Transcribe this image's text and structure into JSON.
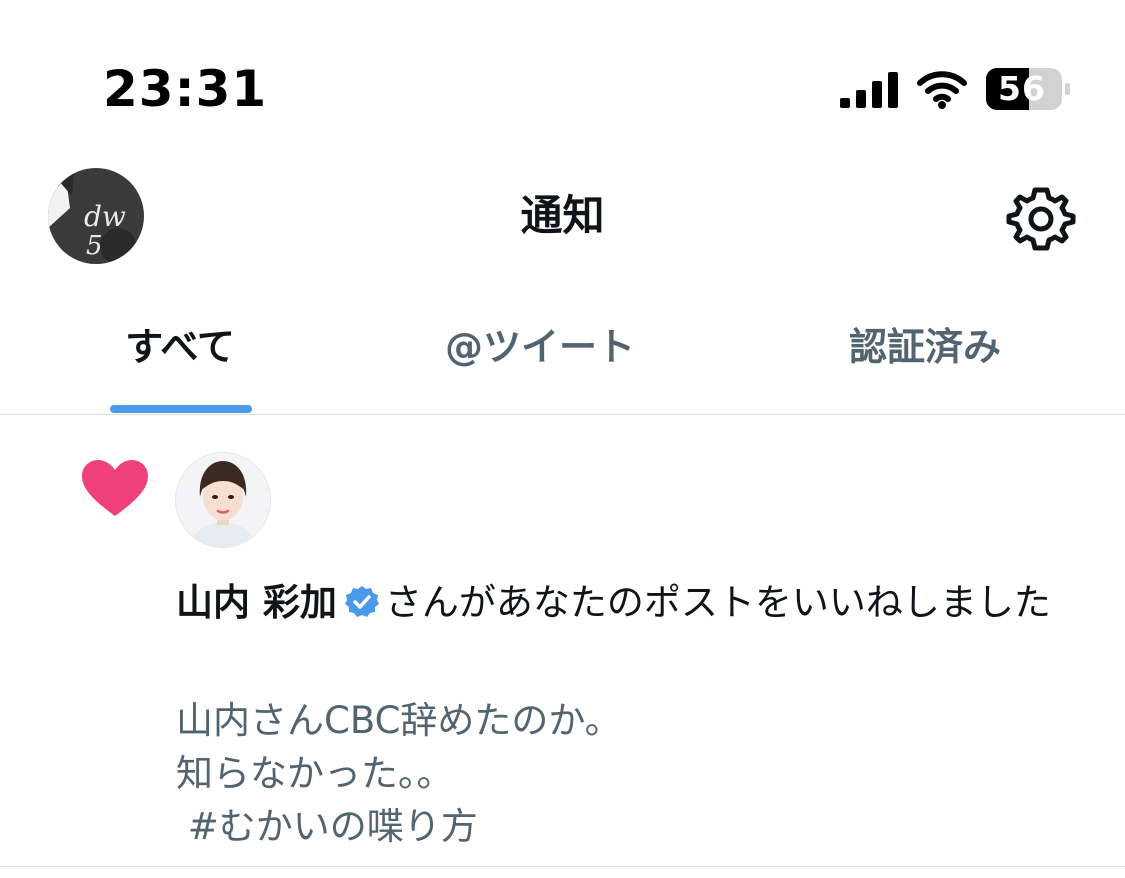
{
  "status_bar": {
    "time": "23:31",
    "battery": "56",
    "icons": [
      "signal-icon",
      "wifi-icon",
      "battery-icon"
    ]
  },
  "header": {
    "title": "通知",
    "avatar_text": "dw5",
    "settings_icon": "gear-icon"
  },
  "tabs": [
    {
      "label": "すべて",
      "active": true
    },
    {
      "label": "@ツイート",
      "active": false
    },
    {
      "label": "認証済み",
      "active": false
    }
  ],
  "notification": {
    "type_icon": "heart-icon",
    "actor_name": "山内 彩加",
    "verified": true,
    "action_text": "さんがあなたのポストをいいねしました",
    "post_lines": [
      "山内さんCBC辞めたのか。",
      "知らなかった。。",
      " #むかいの喋り方"
    ]
  },
  "colors": {
    "accent": "#4b99e9",
    "like": "#f0407c",
    "verified": "#4b99e9",
    "secondary_text": "#536471",
    "primary_text": "#0f1419",
    "divider": "#dde1e4"
  }
}
